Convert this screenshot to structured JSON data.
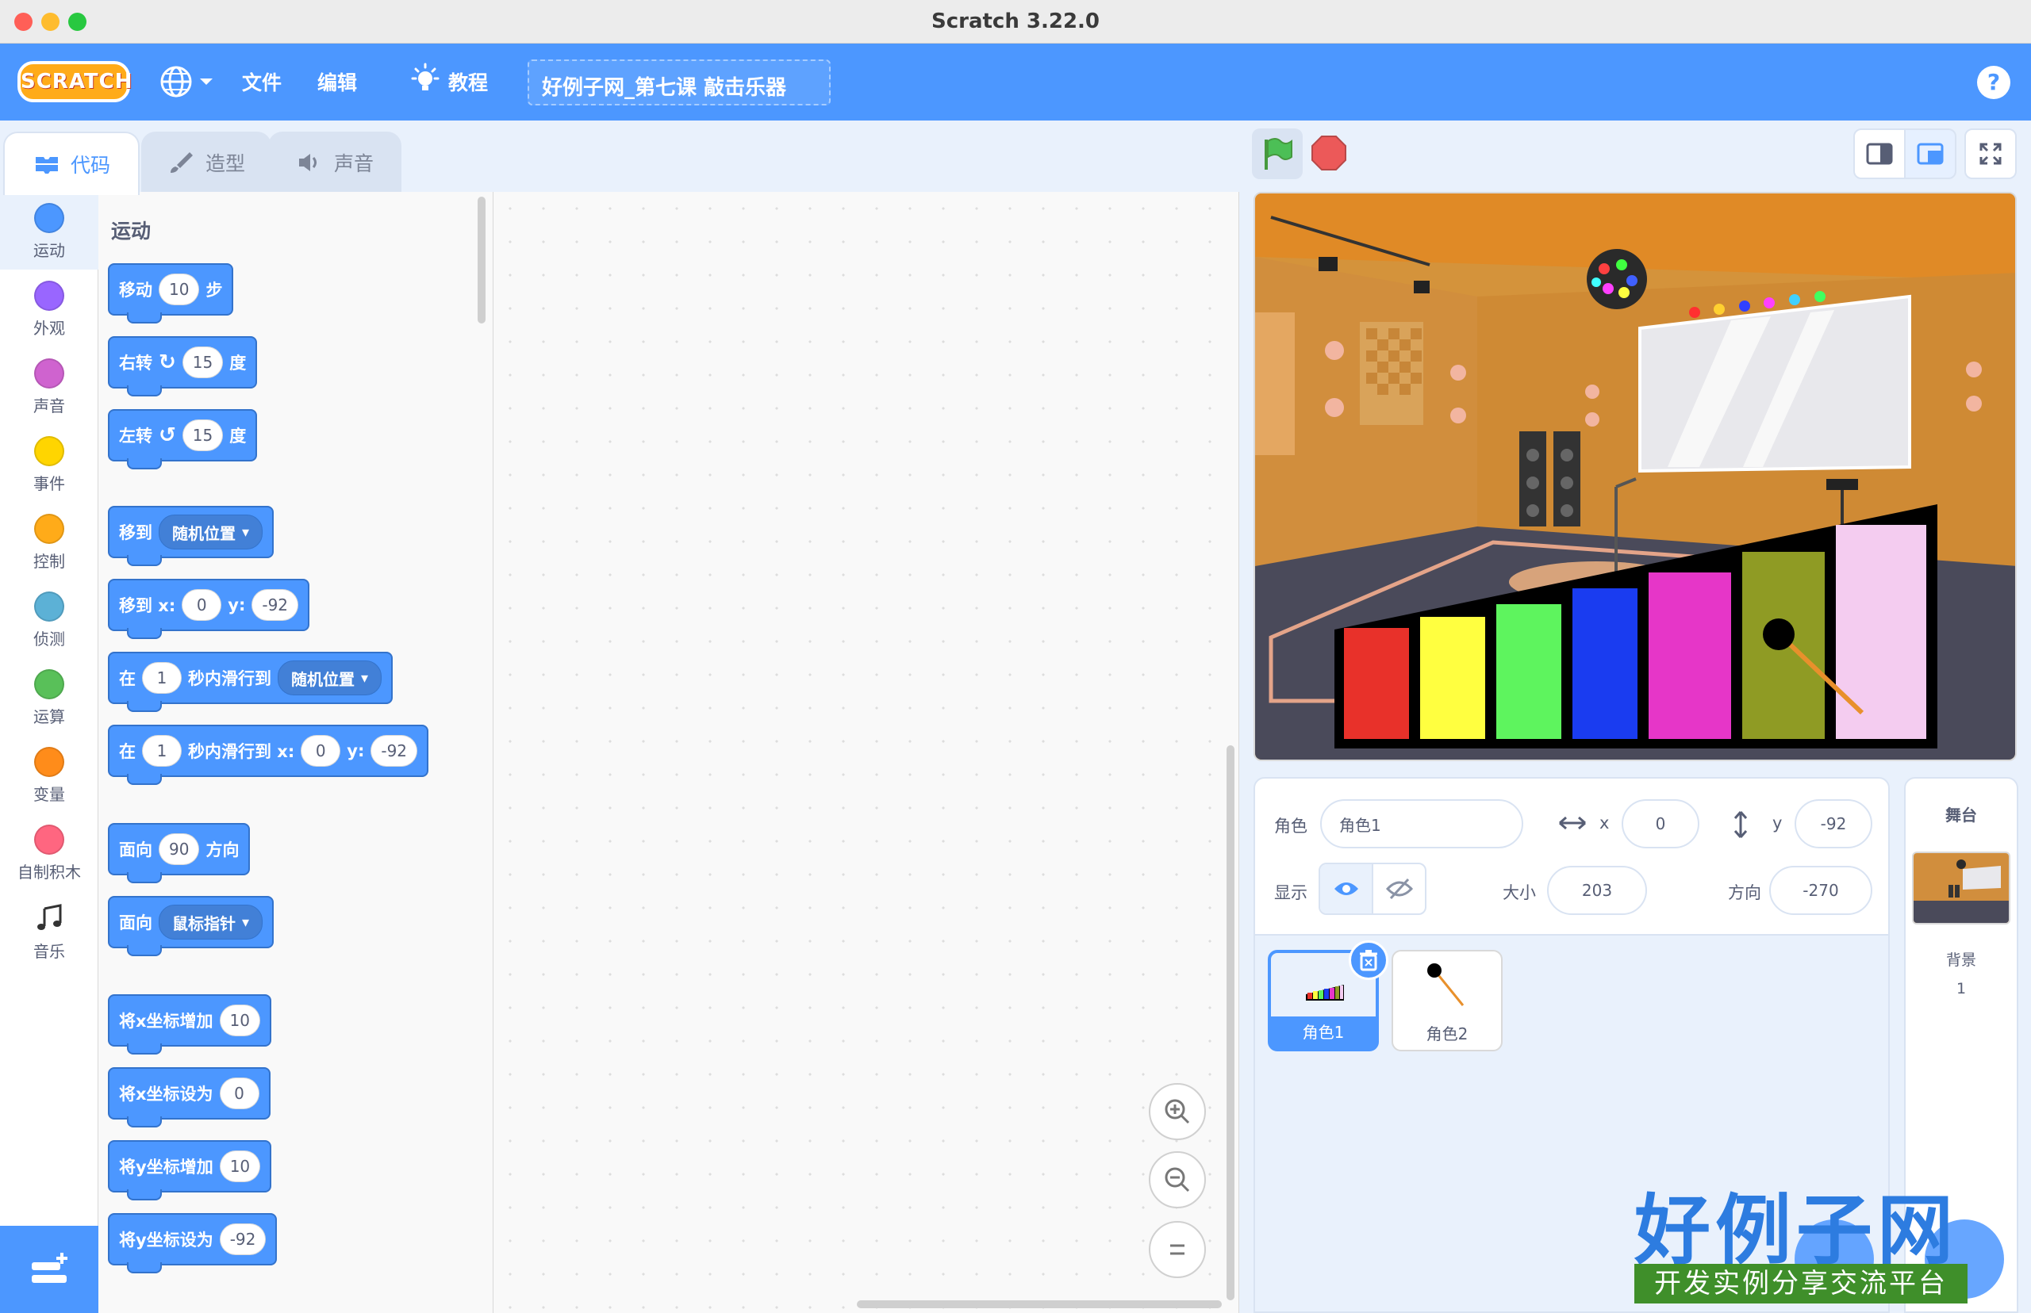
{
  "window": {
    "title": "Scratch 3.22.0"
  },
  "menubar": {
    "logo": "SCRATCH",
    "file": "文件",
    "edit": "编辑",
    "tutorials": "教程",
    "project_title": "好例子网_第七课 敲击乐器",
    "help": "?"
  },
  "tabs": [
    {
      "label": "代码",
      "icon": "code-icon",
      "active": true
    },
    {
      "label": "造型",
      "icon": "brush-icon",
      "active": false
    },
    {
      "label": "声音",
      "icon": "speaker-icon",
      "active": false
    }
  ],
  "categories": [
    {
      "label": "运动",
      "color": "#4c97ff"
    },
    {
      "label": "外观",
      "color": "#9966ff"
    },
    {
      "label": "声音",
      "color": "#cf63cf"
    },
    {
      "label": "事件",
      "color": "#ffd500"
    },
    {
      "label": "控制",
      "color": "#ffab19"
    },
    {
      "label": "侦测",
      "color": "#5cb1d6"
    },
    {
      "label": "运算",
      "color": "#59c059"
    },
    {
      "label": "变量",
      "color": "#ff8c1a"
    },
    {
      "label": "自制积木",
      "color": "#ff6680"
    },
    {
      "label": "音乐",
      "icon": "music-note-icon"
    }
  ],
  "palette": {
    "section": "运动",
    "blocks": {
      "move": {
        "text": "移动",
        "value": "10",
        "suffix": "步"
      },
      "turn_right": {
        "text": "右转",
        "value": "15",
        "suffix": "度"
      },
      "turn_left": {
        "text": "左转",
        "value": "15",
        "suffix": "度"
      },
      "goto": {
        "text": "移到",
        "menu": "随机位置"
      },
      "goto_xy": {
        "text": "移到 x:",
        "x": "0",
        "ylabel": "y:",
        "y": "-92"
      },
      "glide_to": {
        "prefix": "在",
        "secs": "1",
        "text": "秒内滑行到",
        "menu": "随机位置"
      },
      "glide_xy": {
        "prefix": "在",
        "secs": "1",
        "text": "秒内滑行到 x:",
        "x": "0",
        "ylabel": "y:",
        "y": "-92"
      },
      "point_dir": {
        "text": "面向",
        "value": "90",
        "suffix": "方向"
      },
      "point_towards": {
        "text": "面向",
        "menu": "鼠标指针"
      },
      "change_x": {
        "text": "将x坐标增加",
        "value": "10"
      },
      "set_x": {
        "text": "将x坐标设为",
        "value": "0"
      },
      "change_y": {
        "text": "将y坐标增加",
        "value": "10"
      },
      "set_y": {
        "text": "将y坐标设为",
        "value": "-92"
      }
    }
  },
  "sprite_info": {
    "sprite_label": "角色",
    "sprite_name": "角色1",
    "x_label": "x",
    "x": "0",
    "y_label": "y",
    "y": "-92",
    "show_label": "显示",
    "size_label": "大小",
    "size": "203",
    "direction_label": "方向",
    "direction": "-270"
  },
  "sprites": [
    {
      "name": "角色1",
      "selected": true
    },
    {
      "name": "角色2",
      "selected": false
    }
  ],
  "stage_pane": {
    "header": "舞台",
    "backdrop_label": "背景",
    "backdrop_count": "1"
  },
  "watermark": {
    "brand": "好例子网",
    "tagline": "开发实例分享交流平台"
  },
  "colors": {
    "accent": "#4c97ff",
    "motion": "#4c97ff",
    "xylophone_bars": [
      "#e8312a",
      "#ffff40",
      "#5ef45e",
      "#1a3cf0",
      "#e636c8",
      "#8f9b24",
      "#f4ccf0"
    ]
  }
}
